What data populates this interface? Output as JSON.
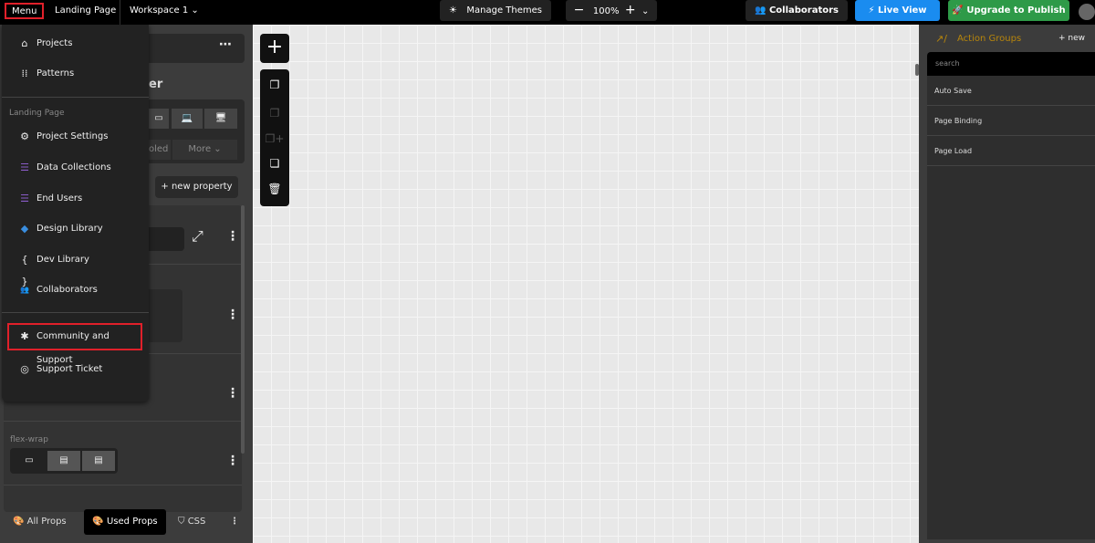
{
  "topbar": {
    "menu": "Menu",
    "page": "Landing Page",
    "workspace": "Workspace 1",
    "themes": "Manage Themes",
    "zoom": "100%",
    "collaborators": "Collaborators",
    "live_view": "Live View",
    "upgrade": "Upgrade to Publish"
  },
  "menu": {
    "items": [
      {
        "label": "Projects",
        "icon": "home-icon"
      },
      {
        "label": "Patterns",
        "icon": "grid-icon"
      }
    ],
    "section": "Landing Page",
    "section_items": [
      {
        "label": "Project Settings",
        "icon": "gear-icon"
      },
      {
        "label": "Data Collections",
        "icon": "database-icon"
      },
      {
        "label": "End Users",
        "icon": "users-db-icon"
      },
      {
        "label": "Design Library",
        "icon": "layers-icon"
      },
      {
        "label": "Dev Library",
        "icon": "braces-icon"
      },
      {
        "label": "Collaborators",
        "icon": "people-icon"
      }
    ],
    "support": [
      {
        "label": "Community and Support",
        "icon": "community-icon"
      },
      {
        "label": "Support Ticket",
        "icon": "lifebuoy-icon"
      }
    ]
  },
  "leftpanel": {
    "heading_fragment": "er",
    "enabled_fragment": "oled",
    "more": "More",
    "new_property": "+ new property",
    "flex_wrap": "flex-wrap"
  },
  "bottom_tabs": {
    "all_props": "All Props",
    "used_props": "Used Props",
    "css": "CSS"
  },
  "right": {
    "title": "Action Groups",
    "new": "+ new",
    "search_placeholder": "search",
    "groups": [
      "Auto Save",
      "Page Binding",
      "Page Load"
    ]
  },
  "colors": {
    "live_view": "#1a8cf0",
    "upgrade": "#2e9a48",
    "highlight": "#e0202a",
    "action_groups": "#b8860b"
  }
}
